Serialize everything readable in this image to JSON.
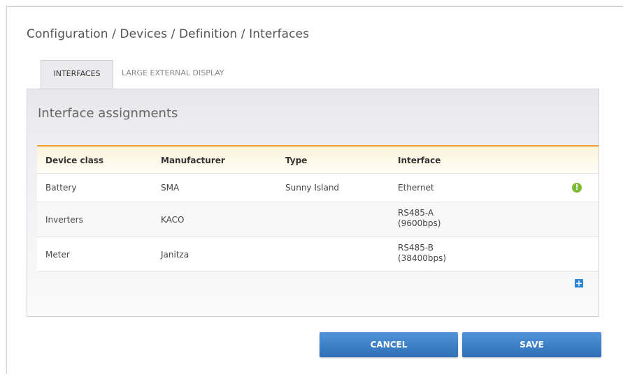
{
  "breadcrumb": "Configuration / Devices / Definition / Interfaces",
  "tabs": [
    {
      "label": "INTERFACES",
      "active": true
    },
    {
      "label": "LARGE EXTERNAL DISPLAY",
      "active": false
    }
  ],
  "panel": {
    "title": "Interface assignments"
  },
  "table": {
    "headers": [
      "Device class",
      "Manufacturer",
      "Type",
      "Interface"
    ],
    "rows": [
      {
        "device_class": "Battery",
        "manufacturer": "SMA",
        "type": "Sunny Island",
        "interface_line1": "Ethernet",
        "interface_line2": "",
        "status": "warning"
      },
      {
        "device_class": "Inverters",
        "manufacturer": "KACO",
        "type": "",
        "interface_line1": "RS485-A",
        "interface_line2": "(9600bps)"
      },
      {
        "device_class": "Meter",
        "manufacturer": "Janitza",
        "type": "",
        "interface_line1": "RS485-B",
        "interface_line2": "(38400bps)"
      }
    ]
  },
  "icons": {
    "status": "exclamation-icon",
    "add": "plus-icon"
  },
  "buttons": {
    "cancel": "CANCEL",
    "save": "SAVE"
  },
  "colors": {
    "accent": "#f0a030",
    "button": "#3a7cc4",
    "status_ok": "#7dba36",
    "add_icon": "#2a86d0"
  }
}
